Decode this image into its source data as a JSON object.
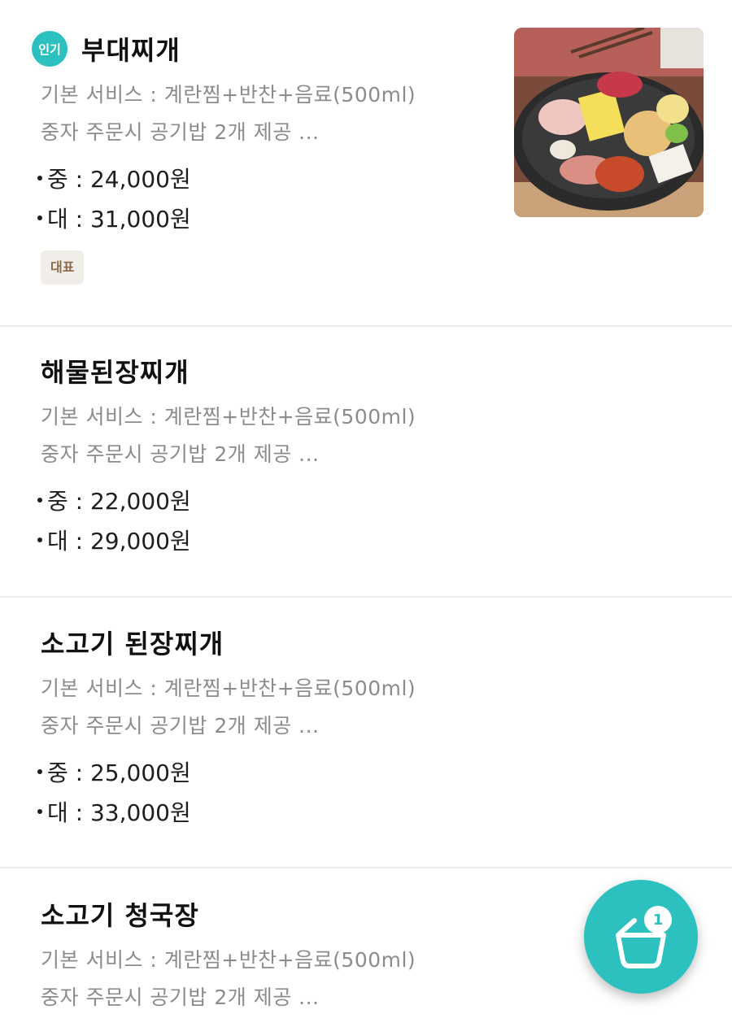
{
  "menu": {
    "items": [
      {
        "badge": "인기",
        "name": "부대찌개",
        "service": "기본 서비스 : 계란찜+반찬+음료(500ml)",
        "note": "중자 주문시 공기밥 2개 제공 ...",
        "price_medium": "중 : 24,000원",
        "price_large": "대 : 31,000원",
        "tag": "대표",
        "image": "budae-jjigae-photo"
      },
      {
        "name": "해물된장찌개",
        "service": "기본 서비스 : 계란찜+반찬+음료(500ml)",
        "note": "중자 주문시 공기밥 2개 제공 ...",
        "price_medium": "중 : 22,000원",
        "price_large": "대 : 29,000원"
      },
      {
        "name": "소고기 된장찌개",
        "service": "기본 서비스 : 계란찜+반찬+음료(500ml)",
        "note": "중자 주문시 공기밥 2개 제공 ...",
        "price_medium": "중 : 25,000원",
        "price_large": "대 : 33,000원"
      },
      {
        "name": "소고기 청국장",
        "service": "기본 서비스 : 계란찜+반찬+음료(500ml)",
        "note": "중자 주문시 공기밥 2개 제공 ..."
      }
    ]
  },
  "cart": {
    "count": "1",
    "icon": "basket-icon"
  },
  "colors": {
    "accent": "#2cc1be",
    "tag_bg": "#f1eee9",
    "tag_text": "#8b6a4a",
    "desc_text": "#8c8c8c"
  }
}
